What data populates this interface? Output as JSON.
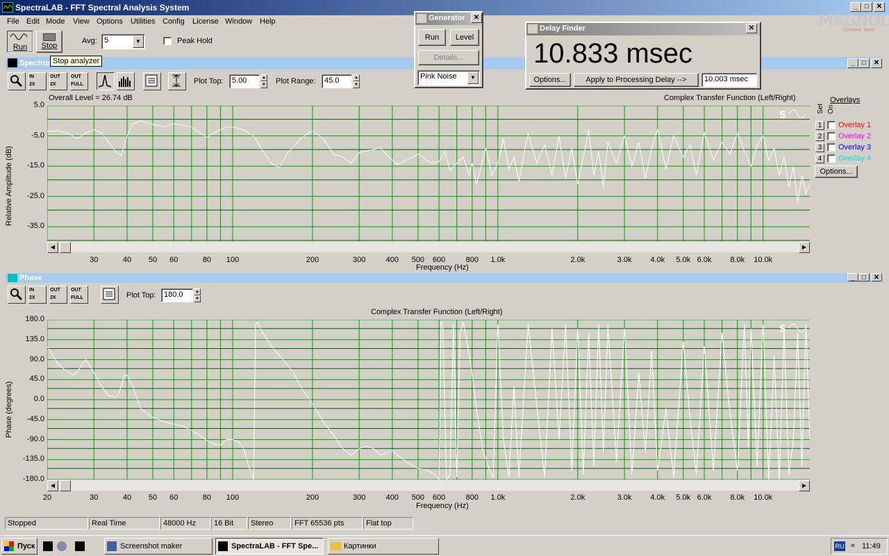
{
  "app": {
    "title": "SpectraLAB - FFT Spectral Analysis System"
  },
  "menu": [
    "File",
    "Edit",
    "Mode",
    "View",
    "Options",
    "Utilities",
    "Config",
    "License",
    "Window",
    "Help"
  ],
  "toolbar": {
    "run_label": "Run",
    "stop_label": "Stop",
    "avg_label": "Avg:",
    "avg_value": "5",
    "peak_hold_label": "Peak Hold",
    "tooltip": "Stop analyzer"
  },
  "watermark": {
    "brand": "MAGNOLIA",
    "sub": "Genuine Team"
  },
  "generator": {
    "title": "Generator",
    "run_label": "Run",
    "level_label": "Level",
    "details_label": "Details...",
    "signal": "Pink Noise"
  },
  "delay_finder": {
    "title": "Delay Finder",
    "value": "10.833 msec",
    "options_label": "Options...",
    "apply_label": "Apply to Processing Delay -->",
    "delay_value": "10.003 msec"
  },
  "spectrum": {
    "title": "Spectrum",
    "plot_top_label": "Plot Top:",
    "plot_top_value": "5.00",
    "plot_range_label": "Plot Range:",
    "plot_range_value": "45.0",
    "overall_level": "Overall Level = 26.74 dB",
    "chart_title": "Complex Transfer Function (Left/Right)",
    "ylabel": "Relative Amplitude (dB)",
    "xlabel": "Frequency (Hz)",
    "overlays_label": "Overlays",
    "set_label": "Set",
    "on_label": "On",
    "options_label": "Options...",
    "overlays": [
      {
        "num": "1",
        "name": "Overlay 1",
        "color": "#ff0000"
      },
      {
        "num": "2",
        "name": "Overlay 2",
        "color": "#ff00ff"
      },
      {
        "num": "3",
        "name": "Overlay 3",
        "color": "#0000ff"
      },
      {
        "num": "4",
        "name": "Overlay 4",
        "color": "#00e0e0"
      }
    ]
  },
  "phase": {
    "title": "Phase",
    "plot_top_label": "Plot Top:",
    "plot_top_value": "180.0",
    "chart_title": "Complex Transfer Function (Left/Right)",
    "ylabel": "Phase (degrees)",
    "xlabel": "Frequency (Hz)"
  },
  "status": [
    "Stopped",
    "Real Time",
    "48000 Hz",
    "16 Bit",
    "Stereo",
    "FFT 65536 pts",
    "Flat top"
  ],
  "taskbar": {
    "start": "Пуск",
    "tasks": [
      "Screenshot maker",
      "SpectraLAB - FFT Spe...",
      "Картинки"
    ],
    "lang": "RU",
    "clock": "11:49"
  },
  "chart_data": [
    {
      "type": "line",
      "title": "Complex Transfer Function (Left/Right)",
      "xlabel": "Frequency (Hz)",
      "ylabel": "Relative Amplitude (dB)",
      "xscale": "log",
      "xlim": [
        20,
        15000
      ],
      "ylim": [
        -40,
        5
      ],
      "yticks": [
        "5.0",
        "-5.0",
        "-15.0",
        "-25.0",
        "-35.0"
      ],
      "xticks": [
        "30",
        "40",
        "50",
        "60",
        "80",
        "100",
        "200",
        "300",
        "400",
        "500",
        "600",
        "800",
        "1.0k",
        "2.0k",
        "3.0k",
        "4.0k",
        "5.0k",
        "6.0k",
        "8.0k",
        "10.0k"
      ],
      "grid": true,
      "x": [
        20,
        22,
        24,
        26,
        28,
        30,
        32,
        34,
        36,
        38,
        40,
        42,
        45,
        50,
        55,
        60,
        65,
        70,
        75,
        80,
        85,
        90,
        95,
        100,
        110,
        120,
        130,
        140,
        150,
        160,
        170,
        180,
        190,
        200,
        220,
        240,
        260,
        280,
        300,
        320,
        340,
        360,
        380,
        400,
        420,
        450,
        480,
        500,
        530,
        560,
        600,
        630,
        660,
        700,
        740,
        780,
        800,
        830,
        860,
        900,
        950,
        1000,
        1050,
        1100,
        1150,
        1200,
        1300,
        1400,
        1500,
        1600,
        1700,
        1800,
        1900,
        2000,
        2100,
        2200,
        2300,
        2400,
        2500,
        2600,
        2800,
        3000,
        3200,
        3400,
        3600,
        3800,
        4000,
        4300,
        4600,
        5000,
        5300,
        5600,
        6000,
        6500,
        7000,
        7500,
        8000,
        8500,
        9000,
        9500,
        10000,
        10500,
        11000,
        11500,
        12000,
        12500,
        13000,
        13500,
        14000,
        14500,
        15000
      ],
      "y": [
        -3.5,
        -3.3,
        -4.2,
        -5.9,
        -4.0,
        -3.0,
        -4.0,
        -7.0,
        -10.0,
        -11.5,
        -5.0,
        -1.0,
        0.0,
        -1.2,
        -2.0,
        -1.0,
        -1.5,
        -2.0,
        -3.8,
        -5.5,
        -4.0,
        -3.0,
        -2.0,
        -2.0,
        -3.0,
        -5.0,
        -10.0,
        -14.0,
        -15.5,
        -11.0,
        -8.5,
        -6.0,
        -4.5,
        -3.3,
        -6.0,
        -11.0,
        -12.0,
        -14.0,
        -10.5,
        -10.0,
        -9.5,
        -9.0,
        -11.0,
        -13.0,
        -14.5,
        -13.0,
        -12.0,
        -11.0,
        -12.5,
        -14.0,
        -13.5,
        -10.0,
        -16.5,
        -14.0,
        -12.0,
        -18.0,
        -14.0,
        -21.0,
        -16.0,
        -9.0,
        -18.0,
        -14.0,
        -6.0,
        -16.0,
        -12.0,
        -20.0,
        -4.0,
        -14.0,
        -8.0,
        -18.0,
        -5.0,
        -19.0,
        -9.0,
        -21.0,
        -12.0,
        -3.0,
        -18.0,
        -10.0,
        -22.0,
        -7.0,
        -14.0,
        -5.0,
        -15.0,
        -7.0,
        -19.0,
        -9.0,
        -3.0,
        -16.0,
        -5.0,
        -12.0,
        -8.0,
        -18.0,
        -4.0,
        -13.0,
        -7.0,
        -11.0,
        -4.0,
        -10.0,
        -15.0,
        -8.0,
        -5.0,
        -13.0,
        -9.0,
        -18.0,
        -12.0,
        -22.0,
        -15.0,
        -27.0,
        -18.0,
        -24.0,
        -21.0
      ]
    },
    {
      "type": "line",
      "title": "Complex Transfer Function (Left/Right)",
      "xlabel": "Frequency (Hz)",
      "ylabel": "Phase (degrees)",
      "xscale": "log",
      "xlim": [
        20,
        15000
      ],
      "ylim": [
        -180,
        180
      ],
      "yticks": [
        "180.0",
        "135.0",
        "90.0",
        "45.0",
        "0.0",
        "-45.0",
        "-90.0",
        "-135.0",
        "-180.0"
      ],
      "xticks": [
        "20",
        "30",
        "40",
        "50",
        "60",
        "80",
        "100",
        "200",
        "300",
        "400",
        "500",
        "600",
        "800",
        "1.0k",
        "2.0k",
        "3.0k",
        "4.0k",
        "5.0k",
        "6.0k",
        "8.0k",
        "10.0k"
      ],
      "grid": true,
      "x": [
        20,
        21,
        22,
        23,
        24,
        25,
        26,
        27,
        28,
        30,
        32,
        34,
        36,
        37,
        38,
        39,
        40,
        42,
        45,
        50,
        55,
        60,
        65,
        70,
        75,
        80,
        85,
        90,
        95,
        100,
        105,
        110,
        115,
        120,
        122,
        124,
        130,
        140,
        150,
        160,
        170,
        180,
        200,
        220,
        240,
        260,
        280,
        300,
        320,
        340,
        360,
        400,
        450,
        500,
        550,
        580,
        600,
        610,
        620,
        640,
        660,
        680,
        700,
        720,
        740,
        760,
        780,
        800,
        830,
        860,
        880,
        900,
        930,
        960,
        1000,
        1050,
        1100,
        1150,
        1200,
        1300,
        1400,
        1500,
        1600,
        1700,
        1800,
        1900,
        2000,
        2100,
        2200,
        2300,
        2400,
        2500,
        2600,
        2800,
        3000,
        3200,
        3400,
        3600,
        3800,
        4000,
        4300,
        4600,
        5000,
        5300,
        5600,
        6000,
        6500,
        7000,
        7500,
        8000,
        8500,
        8800,
        9000,
        9500,
        10000,
        10500,
        11000,
        11500,
        12000,
        12500,
        13000,
        13500,
        14000,
        14500,
        15000
      ],
      "y": [
        120,
        100,
        80,
        70,
        62,
        55,
        62,
        80,
        90,
        60,
        30,
        10,
        5,
        10,
        30,
        55,
        55,
        30,
        -20,
        -40,
        -50,
        -55,
        -60,
        -70,
        -80,
        -92,
        -100,
        -102,
        -90,
        -90,
        -95,
        -110,
        -150,
        -180,
        170,
        175,
        150,
        120,
        100,
        80,
        60,
        30,
        -10,
        -50,
        -80,
        -110,
        -125,
        -110,
        -105,
        -110,
        -125,
        -115,
        -140,
        -155,
        -160,
        -170,
        -180,
        175,
        170,
        -180,
        -170,
        170,
        -175,
        150,
        175,
        140,
        100,
        60,
        -20,
        -80,
        -120,
        -130,
        -160,
        -175,
        170,
        -90,
        -175,
        30,
        -175,
        170,
        -10,
        -175,
        160,
        -90,
        170,
        -160,
        160,
        -170,
        150,
        -150,
        170,
        -120,
        170,
        -140,
        160,
        -170,
        60,
        -120,
        110,
        -160,
        -20,
        -175,
        130,
        -40,
        -170,
        120,
        -160,
        150,
        -30,
        -160,
        170,
        -110,
        160,
        -150,
        170,
        -180,
        100,
        -180,
        160,
        -170,
        -90,
        150,
        -150,
        170,
        -90
      ]
    }
  ]
}
